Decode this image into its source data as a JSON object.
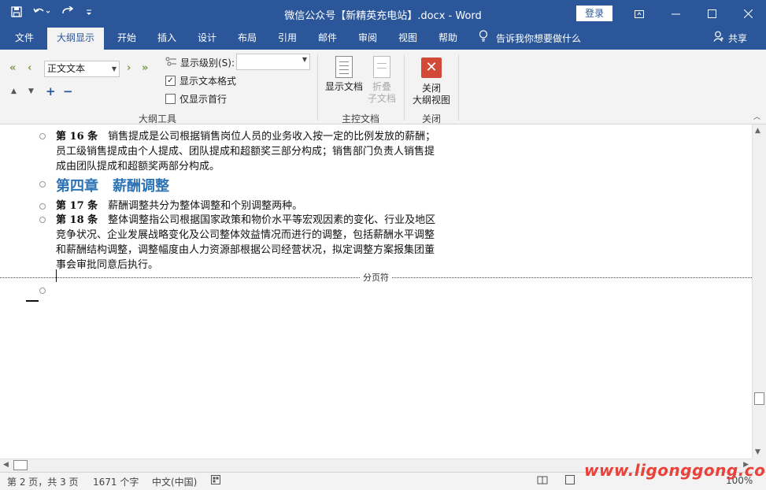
{
  "titlebar": {
    "title": "微信公众号【新精英充电站】.docx  -  Word",
    "login_label": "登录"
  },
  "tabs": [
    {
      "label": "文件"
    },
    {
      "label": "大纲显示"
    },
    {
      "label": "开始"
    },
    {
      "label": "插入"
    },
    {
      "label": "设计"
    },
    {
      "label": "布局"
    },
    {
      "label": "引用"
    },
    {
      "label": "邮件"
    },
    {
      "label": "审阅"
    },
    {
      "label": "视图"
    },
    {
      "label": "帮助"
    }
  ],
  "tellme": "告诉我你想要做什么",
  "share": "共享",
  "ribbon": {
    "outline_tools": {
      "level_value": "正文文本",
      "show_level_label": "显示级别(S):",
      "show_text_format_label": "显示文本格式",
      "show_text_format_checked": true,
      "show_first_line_label": "仅显示首行",
      "show_first_line_checked": false,
      "group_label": "大纲工具"
    },
    "master_document": {
      "show_document_label": "显示文档",
      "collapse_subdocs_line1": "折叠",
      "collapse_subdocs_line2": "子文档",
      "group_label": "主控文档"
    },
    "close": {
      "close_line1": "关闭",
      "close_line2": "大纲视图",
      "group_label": "关闭"
    }
  },
  "document": {
    "para16_label": "第 16 条",
    "para16_line1": "销售提成是公司根据销售岗位人员的业务收入按一定的比例发放的薪酬；",
    "para16_line2": "员工级销售提成由个人提成、团队提成和超额奖三部分构成；销售部门负责人销售提",
    "para16_line3": "成由团队提成和超额奖两部分构成。",
    "heading": "第四章　薪酬调整",
    "para17_label": "第 17 条",
    "para17_text": "薪酬调整共分为整体调整和个别调整两种。",
    "para18_label": "第 18 条",
    "para18_line1": "整体调整指公司根据国家政策和物价水平等宏观因素的变化、行业及地区",
    "para18_line2": "竞争状况、企业发展战略变化及公司整体效益情况而进行的调整，包括薪酬水平调整",
    "para18_line3": "和薪酬结构调整，调整幅度由人力资源部根据公司经营状况，拟定调整方案报集团董",
    "para18_line4": "事会审批同意后执行。",
    "page_break_label": "分页符"
  },
  "status": {
    "page": "第 2 页，共 3 页",
    "words": "1671 个字",
    "language": "中文(中国)",
    "zoom": "100%"
  },
  "watermark": "www.ligonggong.com"
}
